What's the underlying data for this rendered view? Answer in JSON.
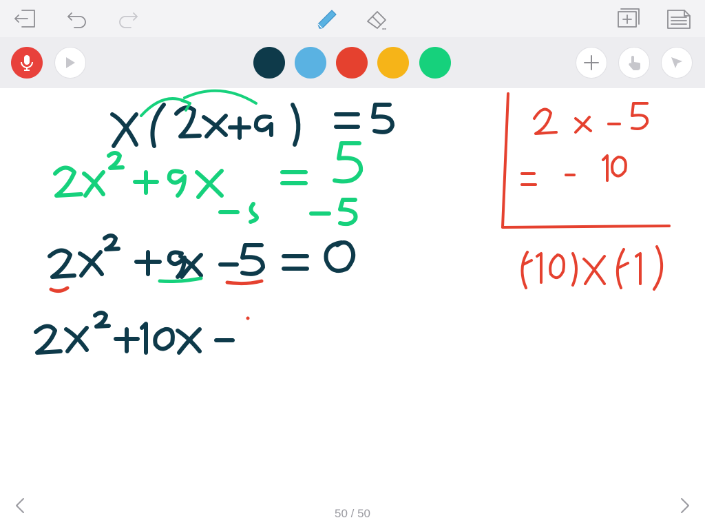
{
  "top_bar": {
    "icons": [
      "exit-icon",
      "undo-icon",
      "redo-icon",
      "pen-icon",
      "eraser-icon",
      "add-page-icon",
      "pages-list-icon"
    ]
  },
  "toolbar": {
    "record": {
      "icon": "microphone-icon",
      "color": "#e8413b"
    },
    "play": {
      "icon": "play-icon"
    },
    "colors": [
      "#0e3a4a",
      "#5ab2e2",
      "#e5412f",
      "#f6b418",
      "#16d17c"
    ],
    "selected_color": "#0e3a4a",
    "right_icons": [
      "plus-icon",
      "hand-icon",
      "pointer-icon"
    ]
  },
  "canvas": {
    "ink_colors": {
      "dark": "#0e3a4a",
      "green": "#16d17c",
      "red": "#e5412f"
    }
  },
  "navigation": {
    "page_indicator": "50 / 50",
    "prev_icon": "chevron-left-icon",
    "next_icon": "chevron-right-icon"
  }
}
